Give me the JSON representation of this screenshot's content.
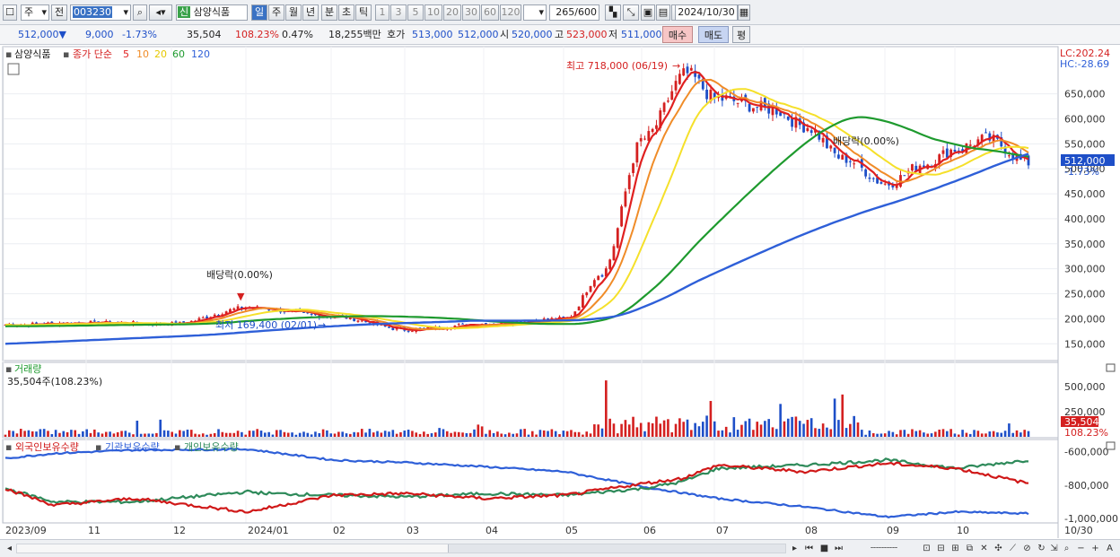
{
  "toolbar": {
    "market": "주",
    "prev": "전",
    "code": "003230",
    "name_badge": "신",
    "name": "삼양식품",
    "periods": [
      "일",
      "주",
      "월",
      "년",
      "분",
      "초",
      "틱"
    ],
    "intervals": [
      "1",
      "3",
      "5",
      "10",
      "20",
      "30",
      "60",
      "120"
    ],
    "count": "265",
    "count_total": "/600",
    "date": "2024/10/30"
  },
  "quote": {
    "price": "512,000",
    "change_arrow": "▼",
    "change": "9,000",
    "change_pct": "-1.73%",
    "volume": "35,504",
    "volume_pct": "108.23%",
    "turnover_pct": "0.47%",
    "amount": "18,255백만",
    "ask_label": "호가",
    "ask": "513,000",
    "bid": "512,000",
    "open_label": "시",
    "open": "520,000",
    "high_label": "고",
    "high": "523,000",
    "low_label": "저",
    "low": "511,000",
    "buy_btn": "매수",
    "sell_btn": "매도",
    "eval_btn": "평"
  },
  "price_panel": {
    "stock": "삼양식품",
    "ma_label": "종가 단순",
    "ma": [
      {
        "period": "5",
        "color": "#e02020"
      },
      {
        "period": "10",
        "color": "#f08c28"
      },
      {
        "period": "20",
        "color": "#f5e02a"
      },
      {
        "period": "60",
        "color": "#1e9a2e"
      },
      {
        "period": "120",
        "color": "#2e5fd8"
      }
    ],
    "lc": "LC:202.24",
    "hc": "HC:-28.69",
    "y_ticks": [
      "650,000",
      "600,000",
      "550,000",
      "500,000",
      "450,000",
      "400,000",
      "350,000",
      "300,000",
      "250,000",
      "200,000",
      "150,000"
    ],
    "last_price_tag": "512,000",
    "last_change_tag": "-1.73%",
    "high_note": "최고 718,000 (06/19)",
    "low_note": "최저 169,400 (02/01)",
    "div_note_1": "배당락(0.00%)",
    "div_note_2": "배당락(0.00%)"
  },
  "volume_panel": {
    "title": "거래량",
    "value": "35,504주(108.23%)",
    "y_ticks": [
      "500,000",
      "250,000"
    ],
    "tag_value": "35,504",
    "tag_pct": "108.23%"
  },
  "holder_panel": {
    "series": [
      {
        "name": "외국인보유수량",
        "color": "#d01818"
      },
      {
        "name": "기관보유수량",
        "color": "#2e5fd8"
      },
      {
        "name": "개인보유수량",
        "color": "#2e8a5a"
      }
    ],
    "y_ticks": [
      "-600,000",
      "-800,000",
      "-1,000,000"
    ]
  },
  "x_axis": [
    "2023/09",
    "11",
    "12",
    "2024/01",
    "02",
    "03",
    "04",
    "05",
    "06",
    "07",
    "08",
    "09",
    "10",
    "10/30"
  ],
  "colors": {
    "up": "#d42020",
    "down": "#1e4fc8",
    "accent": "#3a72c4"
  },
  "chart_data": {
    "type": "line",
    "title": "삼양식품",
    "series_monthly_close": {
      "x": [
        "2023/09",
        "2023/10",
        "2023/11",
        "2023/12",
        "2024/01",
        "2024/02",
        "2024/03",
        "2024/04",
        "2024/05",
        "2024/06",
        "2024/07",
        "2024/08",
        "2024/09",
        "2024/10"
      ],
      "close": [
        190000,
        195000,
        200000,
        215000,
        220000,
        175000,
        195000,
        215000,
        320000,
        680000,
        620000,
        560000,
        490000,
        512000
      ]
    },
    "y_range": [
      120000,
      730000
    ],
    "high": {
      "value": 718000,
      "date": "06/19"
    },
    "low": {
      "value": 169400,
      "date": "02/01"
    }
  }
}
